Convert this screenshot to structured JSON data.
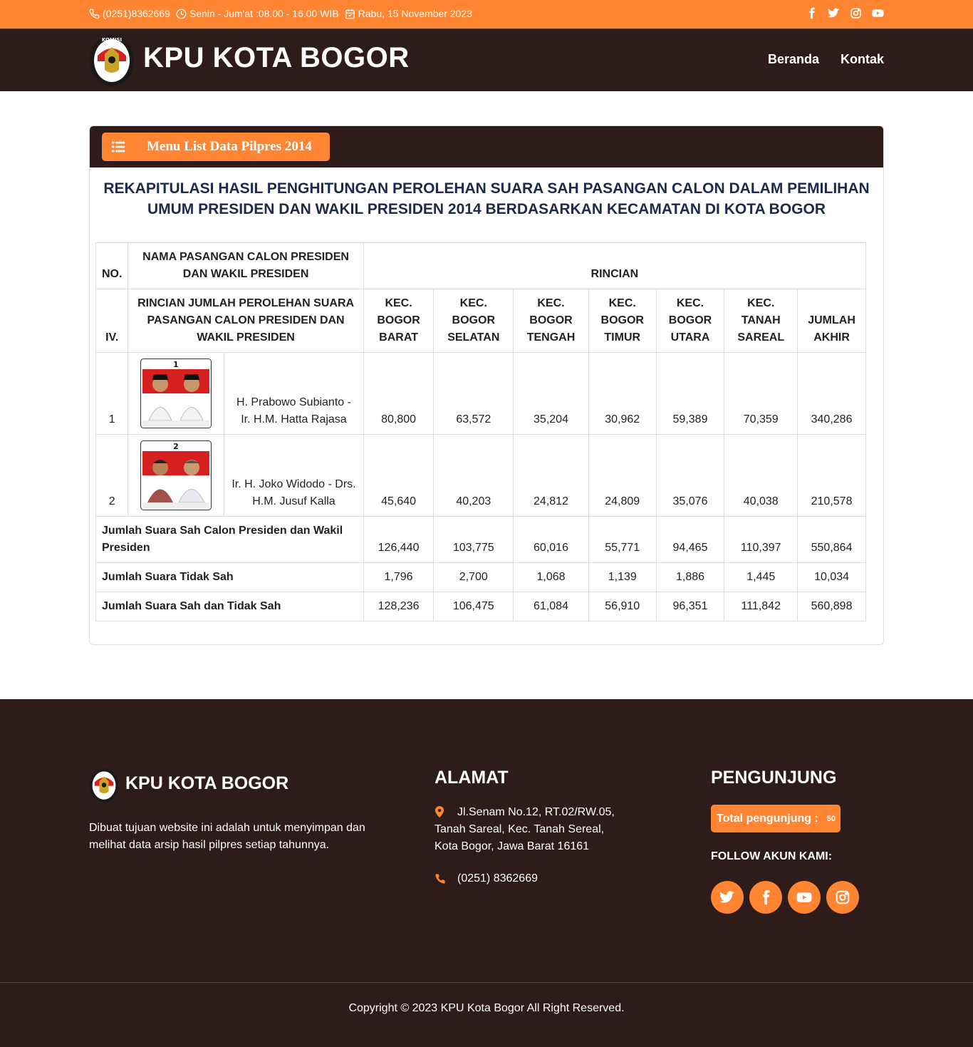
{
  "topbar": {
    "phone": "(0251)8362669",
    "hours": "Senin - Jum'at :08.00 - 16.00 WIB",
    "date": "Rabu, 15 November 2023"
  },
  "header": {
    "brand": "KPU KOTA BOGOR",
    "nav": [
      "Beranda",
      "Kontak"
    ]
  },
  "card": {
    "menu_label": "Menu List Data Pilpres 2014",
    "title": "REKAPITULASI HASIL PENGHITUNGAN PEROLEHAN SUARA SAH PASANGAN CALON DALAM PEMILIHAN UMUM PRESIDEN DAN WAKIL PRESIDEN 2014 BERDASARKAN KECAMATAN DI KOTA BOGOR"
  },
  "table": {
    "h_no": "NO.",
    "h_nama": "NAMA PASANGAN CALON PRESIDEN DAN WAKIL PRESIDEN",
    "h_rincian": "RINCIAN",
    "h_iv": "IV.",
    "h_rincian_jumlah": "RINCIAN JUMLAH PEROLEHAN SUARA PASANGAN CALON PRESIDEN DAN WAKIL PRESIDEN",
    "columns": [
      "KEC. BOGOR BARAT",
      "KEC. BOGOR SELATAN",
      "KEC. BOGOR TENGAH",
      "KEC. BOGOR TIMUR",
      "KEC. BOGOR UTARA",
      "KEC. TANAH SAREAL",
      "JUMLAH AKHIR"
    ],
    "candidates": [
      {
        "no": "1",
        "number": "1",
        "name": "H. Prabowo Subianto - Ir. H.M. Hatta Rajasa",
        "values": [
          "80,800",
          "63,572",
          "35,204",
          "30,962",
          "59,389",
          "70,359",
          "340,286"
        ]
      },
      {
        "no": "2",
        "number": "2",
        "name": "Ir. H. Joko Widodo - Drs. H.M. Jusuf Kalla",
        "values": [
          "45,640",
          "40,203",
          "24,812",
          "24,809",
          "35,076",
          "40,038",
          "210,578"
        ]
      }
    ],
    "totals": [
      {
        "label": "Jumlah Suara Sah Calon Presiden dan Wakil Presiden",
        "values": [
          "126,440",
          "103,775",
          "60,016",
          "55,771",
          "94,465",
          "110,397",
          "550,864"
        ]
      },
      {
        "label": "Jumlah Suara Tidak Sah",
        "values": [
          "1,796",
          "2,700",
          "1,068",
          "1,139",
          "1,886",
          "1,445",
          "10,034"
        ]
      },
      {
        "label": "Jumlah Suara Sah dan Tidak Sah",
        "values": [
          "128,236",
          "106,475",
          "61,084",
          "56,910",
          "96,351",
          "111,842",
          "560,898"
        ]
      }
    ]
  },
  "footer": {
    "brand": "KPU KOTA BOGOR",
    "desc": "Dibuat tujuan website ini adalah untuk menyimpan dan melihat data arsip hasil pilpres setiap tahunnya.",
    "alamat_title": "ALAMAT",
    "address": "Jl.Senam No.12, RT.02/RW.05, Tanah Sareal, Kec. Tanah Sereal, Kota Bogor, Jawa Barat 16161",
    "phone": "(0251) 8362669",
    "pengunjung_title": "PENGUNJUNG",
    "visitor_label": "Total pengunjung :",
    "visitor_count": "50",
    "follow": "FOLLOW AKUN KAMI:",
    "copyright": "Copyright © 2023 KPU Kota Bogor All Right Reserved."
  },
  "colors": {
    "accent": "#ff8533",
    "dark": "#2e1c1b",
    "title": "#1e2a4a"
  },
  "icons": {
    "topbar": [
      "phone-icon",
      "clock-icon",
      "calendar-icon",
      "facebook-icon",
      "twitter-icon",
      "instagram-icon",
      "youtube-icon"
    ],
    "menu": "list-icon",
    "footer": [
      "map-pin-icon",
      "phone-icon",
      "twitter-icon",
      "facebook-icon",
      "youtube-icon",
      "instagram-icon"
    ]
  }
}
